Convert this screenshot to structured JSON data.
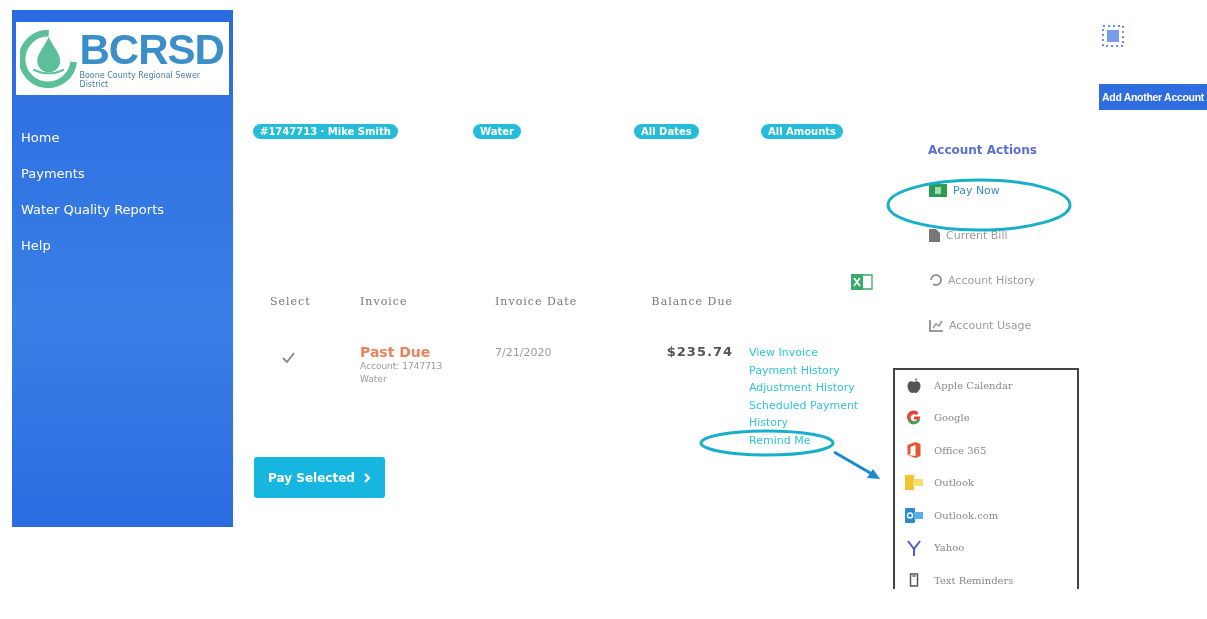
{
  "logo": {
    "name": "BCRSD",
    "tagline": "Boone County Regional Sewer District"
  },
  "sidebar": {
    "items": [
      {
        "label": "Home"
      },
      {
        "label": "Payments"
      },
      {
        "label": "Water Quality Reports"
      },
      {
        "label": "Help"
      }
    ]
  },
  "add_account_button": "Add Another Account",
  "filters": [
    "#1747713 · Mike Smith",
    "Water",
    "All Dates",
    "All Amounts"
  ],
  "table": {
    "columns": [
      "Select",
      "Invoice",
      "Invoice Date",
      "Balance Due"
    ],
    "rows": [
      {
        "checked": true,
        "status": "Past Due",
        "account": "Account: 1747713",
        "service": "Water",
        "date": "7/21/2020",
        "balance": "$235.74",
        "links": [
          "View Invoice",
          "Payment History",
          "Adjustment History",
          "Scheduled Payment History",
          "Remind Me"
        ]
      }
    ]
  },
  "pay_button": "Pay Selected",
  "account_actions": {
    "title": "Account Actions",
    "items": [
      {
        "label": "Pay Now",
        "disabled": false
      },
      {
        "label": "Current Bill",
        "disabled": true
      },
      {
        "label": "Account History",
        "disabled": true
      },
      {
        "label": "Account Usage",
        "disabled": true
      }
    ]
  },
  "reminder_menu": {
    "items": [
      "Apple Calendar",
      "Google",
      "Office 365",
      "Outlook",
      "Outlook.com",
      "Yahoo",
      "Text Reminders"
    ]
  }
}
